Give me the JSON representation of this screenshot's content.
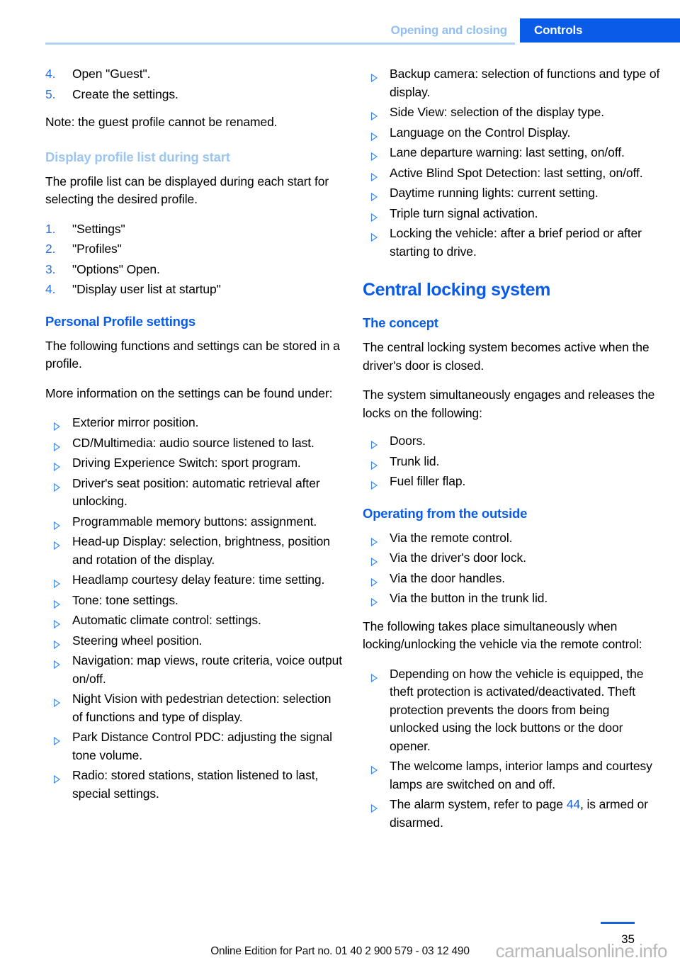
{
  "header": {
    "chapter": "Opening and closing",
    "section": "Controls"
  },
  "left_column": {
    "steps_guest": [
      {
        "num": "4.",
        "text": "Open \"Guest\"."
      },
      {
        "num": "5.",
        "text": "Create the settings."
      }
    ],
    "note": "Note: the guest profile cannot be renamed.",
    "heading_display_profile": "Display profile list during start",
    "intro_display_profile": "The profile list can be displayed during each start for selecting the desired profile.",
    "steps_display_profile": [
      {
        "num": "1.",
        "text": "\"Settings\""
      },
      {
        "num": "2.",
        "text": "\"Profiles\""
      },
      {
        "num": "3.",
        "text": "\"Options\" Open."
      },
      {
        "num": "4.",
        "text": "\"Display user list at startup\""
      }
    ],
    "heading_personal_profile": "Personal Profile settings",
    "intro_personal_profile": "The following functions and settings can be stored in a profile.",
    "more_info": "More information on the settings can be found under:",
    "settings_bullets": [
      "Exterior mirror position.",
      "CD/Multimedia: audio source listened to last.",
      "Driving Experience Switch: sport program.",
      "Driver's seat position: automatic retrieval after unlocking.",
      "Programmable memory buttons: assignment.",
      "Head-up Display: selection, brightness, position and rotation of the display.",
      "Headlamp courtesy delay feature: time setting.",
      "Tone: tone settings.",
      "Automatic climate control: settings.",
      "Steering wheel position.",
      "Navigation: map views, route criteria, voice output on/off.",
      "Night Vision with pedestrian detection: selection of functions and type of display.",
      "Park Distance Control PDC: adjusting the signal tone volume.",
      "Radio: stored stations, station listened to last, special settings."
    ]
  },
  "right_column": {
    "settings_bullets_continued": [
      "Backup camera: selection of functions and type of display.",
      "Side View: selection of the display type.",
      "Language on the Control Display.",
      "Lane departure warning: last setting, on/off.",
      "Active Blind Spot Detection: last setting, on/off.",
      "Daytime running lights: current setting.",
      "Triple turn signal activation.",
      "Locking the vehicle: after a brief period or after starting to drive."
    ],
    "heading_central_locking": "Central locking system",
    "heading_concept": "The concept",
    "concept_para_1": "The central locking system becomes active when the driver's door is closed.",
    "concept_para_2": "The system simultaneously engages and releases the locks on the following:",
    "concept_bullets": [
      "Doors.",
      "Trunk lid.",
      "Fuel filler flap."
    ],
    "heading_operating_outside": "Operating from the outside",
    "operating_bullets": [
      "Via the remote control.",
      "Via the driver's door lock.",
      "Via the door handles.",
      "Via the button in the trunk lid."
    ],
    "simultaneous_para": "The following takes place simultaneously when locking/unlocking the vehicle via the remote control:",
    "simultaneous_bullets": [
      {
        "text_before": "Depending on how the vehicle is equipped, the theft protection is activated/deactivated. Theft protection prevents the doors from being unlocked using the lock buttons or the door opener.",
        "xref": "",
        "text_after": ""
      },
      {
        "text_before": "The welcome lamps, interior lamps and courtesy lamps are switched on and off.",
        "xref": "",
        "text_after": ""
      },
      {
        "text_before": "The alarm system, refer to page ",
        "xref": "44",
        "text_after": ", is armed or disarmed."
      }
    ]
  },
  "footer": {
    "page_number": "35",
    "edition_note": "Online Edition for Part no. 01 40 2 900 579 - 03 12 490",
    "watermark": "carmanualsonline.info"
  }
}
